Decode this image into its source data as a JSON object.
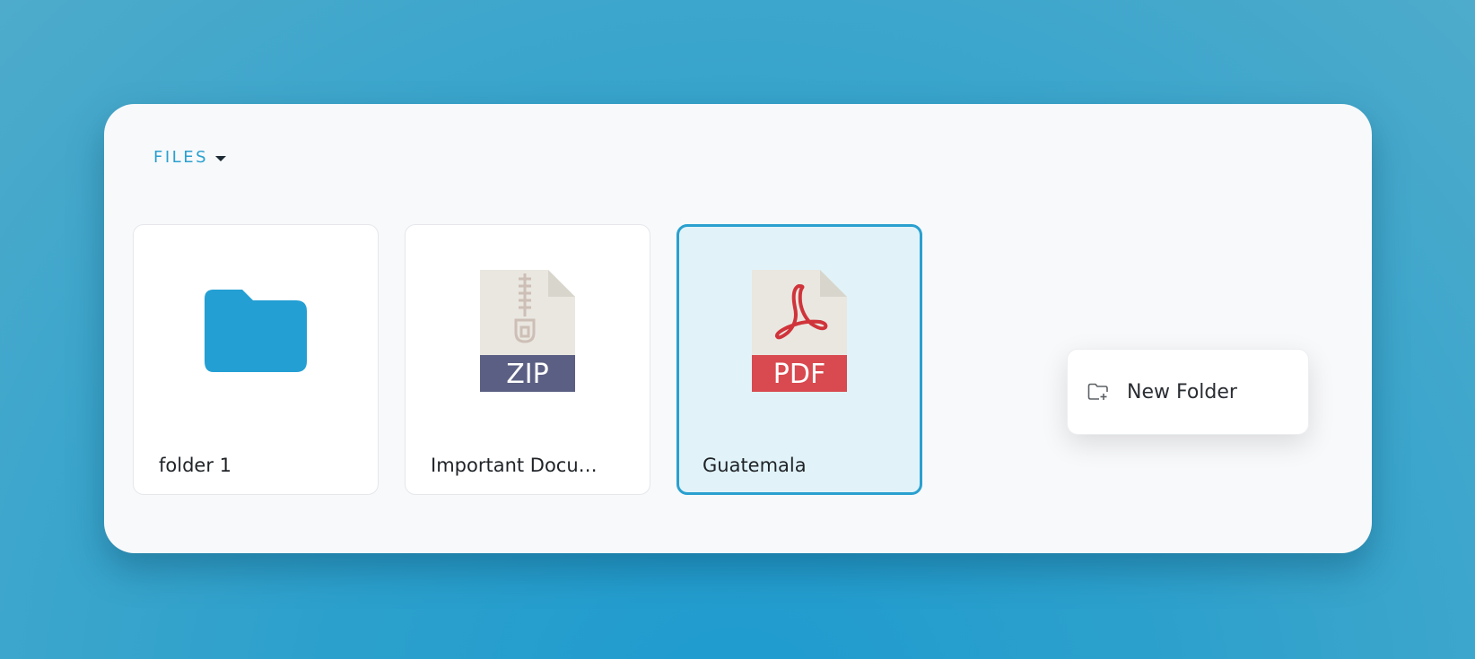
{
  "header": {
    "files_label": "FILES"
  },
  "items": [
    {
      "name": "folder 1",
      "type": "folder",
      "icon": "folder-icon",
      "selected": false
    },
    {
      "name": "Important Docu…",
      "type": "zip",
      "icon": "zip-file-icon",
      "badge": "ZIP",
      "selected": false
    },
    {
      "name": "Guatemala",
      "type": "pdf",
      "icon": "pdf-file-icon",
      "badge": "PDF",
      "selected": true
    }
  ],
  "context_menu": {
    "items": [
      {
        "label": "New Folder",
        "icon": "new-folder-icon"
      }
    ]
  },
  "colors": {
    "accent": "#2aa0cf",
    "folder": "#239fd3",
    "zip_band": "#5b5f83",
    "pdf_band": "#d84a4f",
    "selected_bg": "#e1f3f9"
  }
}
